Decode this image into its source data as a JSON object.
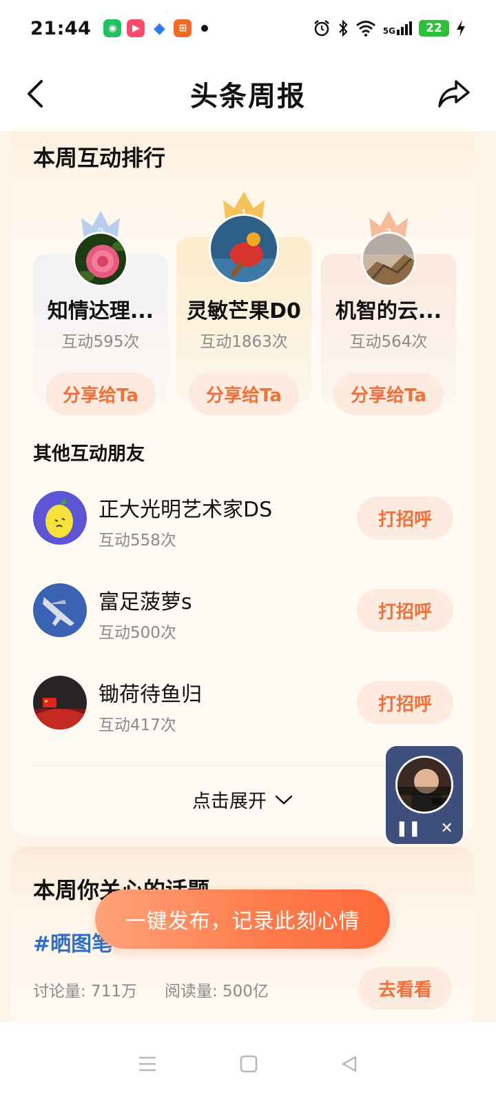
{
  "status_bar": {
    "time": "21:44",
    "battery": "22",
    "network": "5G",
    "apps": [
      "wechat-icon",
      "video-icon",
      "browser-icon",
      "app-icon"
    ]
  },
  "header": {
    "title": "头条周报"
  },
  "ranking": {
    "title": "本周互动排行",
    "top": [
      {
        "rank": "2",
        "name": "知情达理...",
        "count": "互动595次",
        "button": "分享给Ta"
      },
      {
        "rank": "1",
        "name": "灵敏芒果D0",
        "count": "互动1863次",
        "button": "分享给Ta"
      },
      {
        "rank": "3",
        "name": "机智的云...",
        "count": "互动564次",
        "button": "分享给Ta"
      }
    ],
    "others_title": "其他互动朋友",
    "others": [
      {
        "name": "正大光明艺术家DS",
        "count": "互动558次",
        "button": "打招呼"
      },
      {
        "name": "富足菠萝s",
        "count": "互动500次",
        "button": "打招呼"
      },
      {
        "name": "锄荷待鱼归",
        "count": "互动417次",
        "button": "打招呼"
      }
    ],
    "expand_label": "点击展开"
  },
  "topics": {
    "title": "本周你关心的话题",
    "tag": "#晒图笔",
    "discuss": "讨论量: 711万",
    "read": "阅读量: 500亿",
    "button": "去看看"
  },
  "publish": {
    "label": "一键发布，记录此刻心情"
  },
  "colors": {
    "accent": "#f0703a",
    "button_bg": "#fdebe0",
    "topic_link": "#2a6ec8",
    "page_bg": "#fdf3e8"
  }
}
